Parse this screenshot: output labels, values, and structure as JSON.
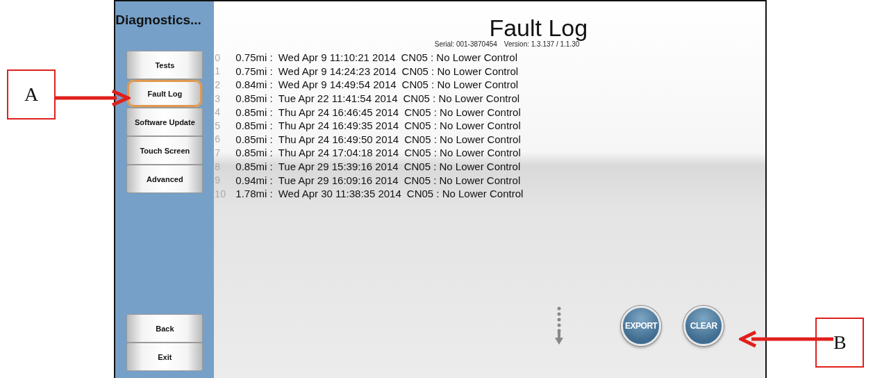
{
  "sidebar": {
    "title": "Diagnostics...",
    "items": [
      {
        "label": "Tests",
        "selected": false
      },
      {
        "label": "Fault Log",
        "selected": true
      },
      {
        "label": "Software Update",
        "selected": false
      },
      {
        "label": "Touch Screen",
        "selected": false
      },
      {
        "label": "Advanced",
        "selected": false
      }
    ],
    "bottom_buttons": [
      "Back",
      "Exit"
    ]
  },
  "main": {
    "title": "Fault Log",
    "serial": "Serial: 001-3870454",
    "version": "Version: 1.3.137 / 1.1.30",
    "rows": [
      {
        "index": "0",
        "mileage": "0.75mi :",
        "timestamp": "Wed Apr 9 11:10:21 2014",
        "message": "CN05 : No Lower Control"
      },
      {
        "index": "1",
        "mileage": "0.75mi :",
        "timestamp": "Wed Apr 9 14:24:23 2014",
        "message": "CN05 : No Lower Control"
      },
      {
        "index": "2",
        "mileage": "0.84mi :",
        "timestamp": "Wed Apr 9 14:49:54 2014",
        "message": "CN05 : No Lower Control"
      },
      {
        "index": "3",
        "mileage": "0.85mi :",
        "timestamp": "Tue Apr 22 11:41:54 2014",
        "message": "CN05 : No Lower Control"
      },
      {
        "index": "4",
        "mileage": "0.85mi :",
        "timestamp": "Thu Apr 24 16:46:45 2014",
        "message": "CN05 : No Lower Control"
      },
      {
        "index": "5",
        "mileage": "0.85mi :",
        "timestamp": "Thu Apr 24 16:49:35 2014",
        "message": "CN05 : No Lower Control"
      },
      {
        "index": "6",
        "mileage": "0.85mi :",
        "timestamp": "Thu Apr 24 16:49:50 2014",
        "message": "CN05 : No Lower Control"
      },
      {
        "index": "7",
        "mileage": "0.85mi :",
        "timestamp": "Thu Apr 24 17:04:18 2014",
        "message": "CN05 : No Lower Control"
      },
      {
        "index": "8",
        "mileage": "0.85mi :",
        "timestamp": "Tue Apr 29 15:39:16 2014",
        "message": "CN05 : No Lower Control"
      },
      {
        "index": "9",
        "mileage": "0.94mi :",
        "timestamp": "Tue Apr 29 16:09:16 2014",
        "message": "CN05 : No Lower Control"
      },
      {
        "index": "10",
        "mileage": "1.78mi :",
        "timestamp": "Wed Apr 30 11:38:35 2014",
        "message": "CN05 : No Lower Control"
      }
    ],
    "actions": [
      "EXPORT",
      "CLEAR"
    ]
  },
  "callouts": [
    {
      "label": "A"
    },
    {
      "label": "B"
    }
  ]
}
